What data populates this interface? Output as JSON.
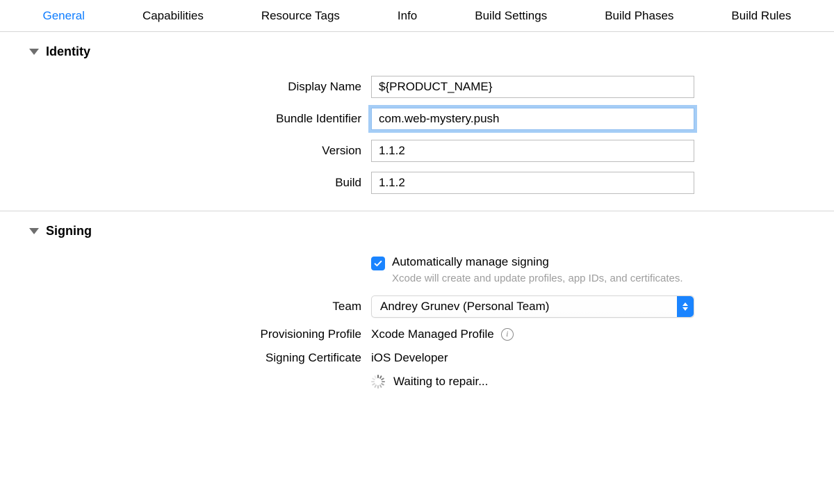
{
  "tabs": {
    "items": [
      {
        "label": "General",
        "active": true
      },
      {
        "label": "Capabilities",
        "active": false
      },
      {
        "label": "Resource Tags",
        "active": false
      },
      {
        "label": "Info",
        "active": false
      },
      {
        "label": "Build Settings",
        "active": false
      },
      {
        "label": "Build Phases",
        "active": false
      },
      {
        "label": "Build Rules",
        "active": false
      }
    ]
  },
  "identity": {
    "section_title": "Identity",
    "display_name_label": "Display Name",
    "display_name_value": "${PRODUCT_NAME}",
    "bundle_id_label": "Bundle Identifier",
    "bundle_id_value": "com.web-mystery.push",
    "version_label": "Version",
    "version_value": "1.1.2",
    "build_label": "Build",
    "build_value": "1.1.2"
  },
  "signing": {
    "section_title": "Signing",
    "auto_manage_label": "Automatically manage signing",
    "auto_manage_checked": true,
    "auto_manage_sub": "Xcode will create and update profiles, app IDs, and certificates.",
    "team_label": "Team",
    "team_value": "Andrey Grunev (Personal Team)",
    "provisioning_label": "Provisioning Profile",
    "provisioning_value": "Xcode Managed Profile",
    "certificate_label": "Signing Certificate",
    "certificate_value": "iOS Developer",
    "status_text": "Waiting to repair..."
  }
}
